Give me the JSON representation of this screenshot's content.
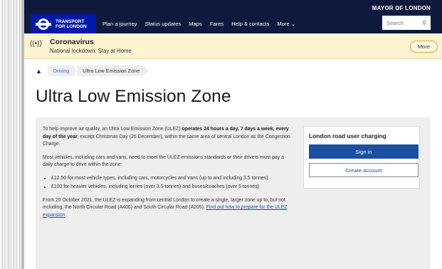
{
  "header": {
    "mayor": "MAYOR OF LONDON",
    "brand_line1": "TRANSPORT",
    "brand_line2": "FOR LONDON",
    "nav": [
      "Plan a journey",
      "Status updates",
      "Maps",
      "Fares",
      "Help & contacts",
      "More"
    ],
    "search_placeholder": "Search"
  },
  "banner": {
    "title": "Coronavirus",
    "subtitle": "National lockdown: Stay at Home",
    "more_label": "More"
  },
  "breadcrumb": {
    "items": [
      "Driving",
      "Ultra Low Emission Zone"
    ]
  },
  "page_title": "Ultra Low Emission Zone",
  "content": {
    "p1_a": "To help improve air quality, an Ultra Low Emission Zone (ULEZ) ",
    "p1_b": "operates 24 hours a day, 7 days a week, every day of the year",
    "p1_c": ", except Christmas Day (25 December), within the same area of central London as the Congestion Charge.",
    "p2": "Most vehicles, including cars and vans, need to meet the ULEZ emissions standards or their drivers must pay a daily charge to drive within the zone:",
    "bullets": [
      "£12.50 for most vehicle types, including cars, motorcycles and vans (up to and including 3.5 tonnes)",
      "£100 for heavier vehicles, including lorries (over 3.5 tonnes) and buses/coaches (over 5 tonnes)"
    ],
    "p3": "From 25 October 2021, the ULEZ is expanding from central London to create a single, larger zone up to, but not including, the North Circular Road (A406) and South Circular Road (A205).",
    "link": "Find out how to prepare for the ULEZ expansion",
    "link_suffix": "."
  },
  "card": {
    "title": "London road user charging",
    "signin": "Sign in",
    "create": "Create account"
  }
}
